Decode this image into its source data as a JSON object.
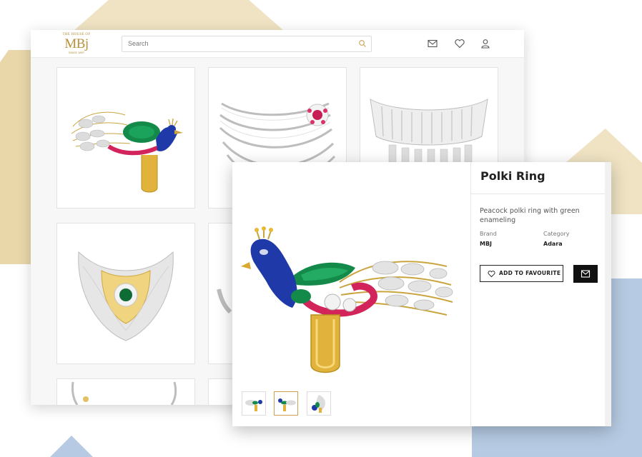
{
  "header": {
    "logo": {
      "top": "THE HOUSE OF",
      "main": "MBj",
      "sub": "SINCE 1897"
    },
    "search_placeholder": "Search",
    "icons": [
      "mail-icon",
      "heart-icon",
      "user-icon"
    ]
  },
  "grid": {
    "items": [
      "peacock-ring",
      "diamond-ruby-necklace",
      "diamond-choker",
      "emerald-gold-necklace",
      "diamond-necklace-partial",
      "diamond-necklace-small",
      "necklace-partial"
    ]
  },
  "product": {
    "title": "Polki Ring",
    "description": "Peacock polki ring with green enameling",
    "brand_label": "Brand",
    "brand_value": "MBJ",
    "category_label": "Category",
    "category_value": "Adara",
    "favourite_label": "ADD TO FAVOURITE",
    "thumbnails": [
      "thumb-peacock-side",
      "thumb-peacock-main",
      "thumb-peacock-top"
    ],
    "active_thumbnail": 1
  },
  "colors": {
    "gold": "#c8a24e",
    "tan_bg": "#e9d7a9",
    "blue_bg": "#b6cbe3",
    "peacock_blue": "#1f3aa8",
    "emerald": "#138a4a",
    "ruby": "#d2245a"
  }
}
